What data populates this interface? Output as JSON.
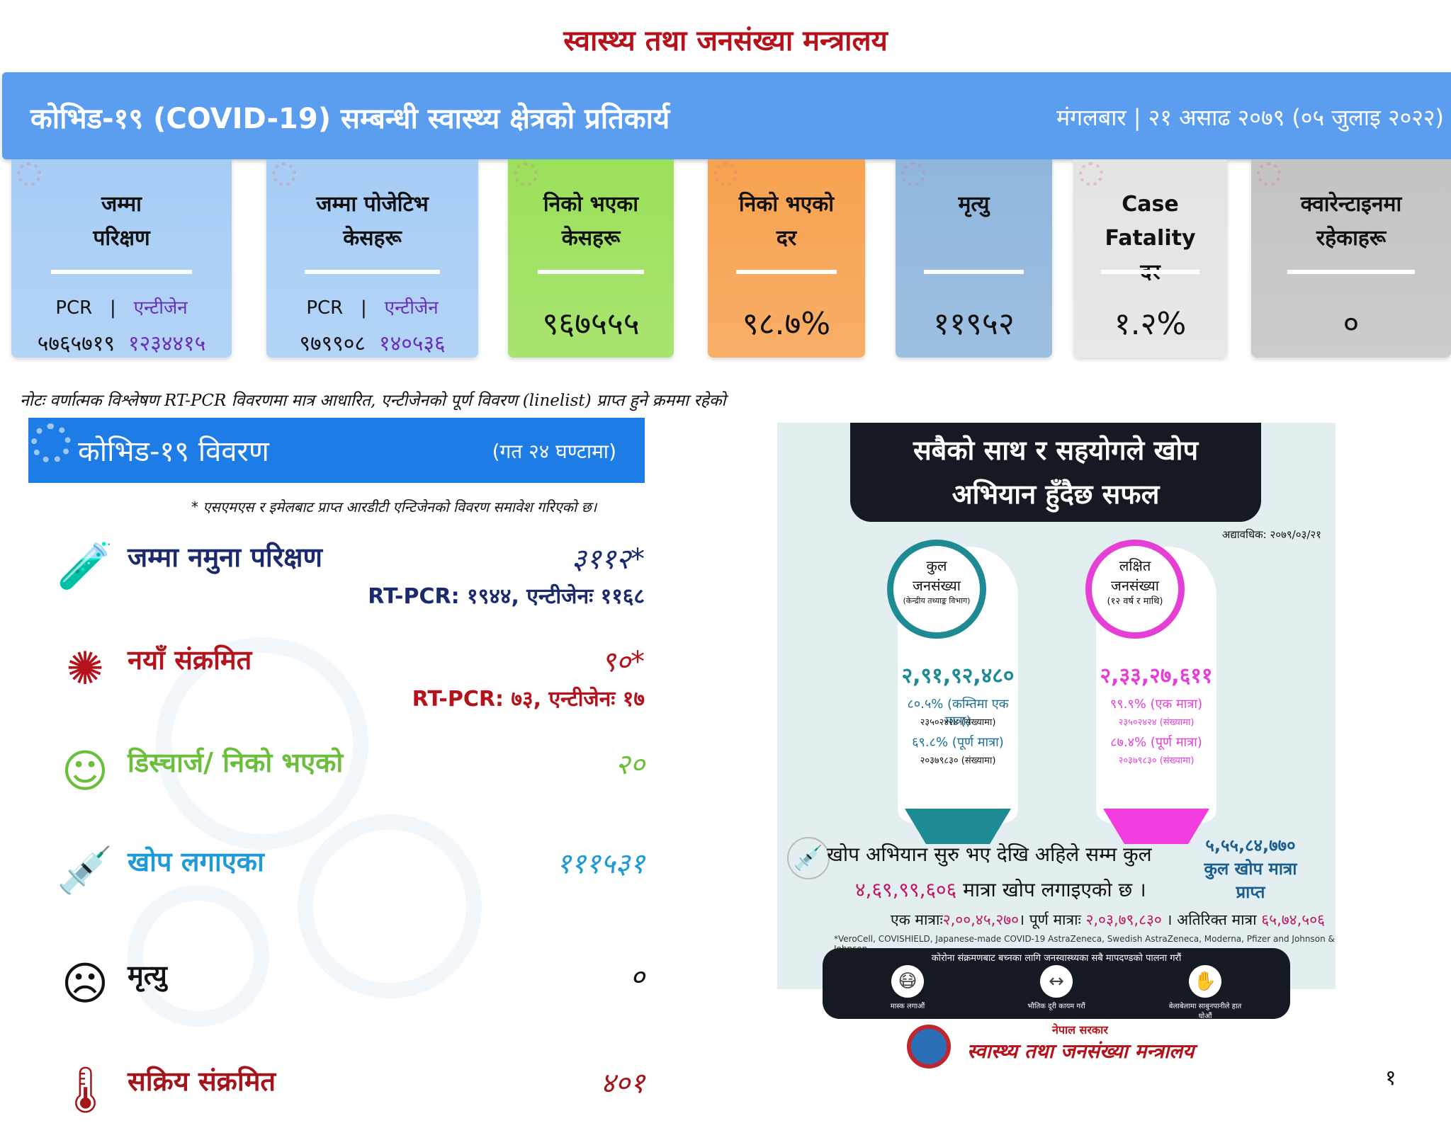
{
  "header": {
    "ministry": "स्वास्थ्य तथा जनसंख्या मन्त्रालय",
    "banner_title": "कोभिड-१९ (COVID-19) सम्बन्धी स्वास्थ्य क्षेत्रको प्रतिकार्य",
    "date": "मंगलबार | २१ असाढ २०७९ (०५ जुलाइ २०२२)"
  },
  "cards": [
    {
      "title1": "जम्मा",
      "title2": "परिक्षण",
      "pcr_label": "PCR",
      "sep": "|",
      "antigen_label": "एन्टीजेन",
      "pcr_value": "५७६५७१९",
      "antigen_value": "१२३४४१५",
      "color": "#a7cdf5"
    },
    {
      "title1": "जम्मा पोजेटिभ",
      "title2": "केसहरू",
      "pcr_label": "PCR",
      "sep": "|",
      "antigen_label": "एन्टीजेन",
      "pcr_value": "९७९९०८",
      "antigen_value": "१४०५३६",
      "color": "#a7cdf5"
    },
    {
      "title1": "निको भएका",
      "title2": "केसहरू",
      "value": "९६७५५५",
      "color": "#9be05a"
    },
    {
      "title1": "निको भएको",
      "title2": "दर",
      "value": "९८.७%",
      "color": "#f7a250"
    },
    {
      "title1": "मृत्यु",
      "title2": "",
      "value": "११९५२",
      "color": "#8fb6dc"
    },
    {
      "title1": "Case",
      "title2": "Fatality",
      "title3": "दर",
      "value": "१.२%",
      "color": "#e4e4e4"
    },
    {
      "title1": "क्वारेन्टाइनमा",
      "title2": "रहेकाहरू",
      "value": "०",
      "color": "#c4c4c4"
    }
  ],
  "note": "नोटः वर्णात्मक विश्लेषण RT-PCR विवरणमा मात्र आधारित, एन्टीजेनको पूर्ण विवरण (linelist) प्राप्त हुने क्रममा रहेको",
  "section": {
    "title": "कोभिड-१९ विवरण",
    "period": "(गत २४ घण्टामा)",
    "asterisk_note": "* एसएमएस र इमेलबाट प्राप्त आरडीटी एन्टिजेनको विवरण समावेश गरिएको छ।"
  },
  "rows": [
    {
      "icon": "test-tube-icon",
      "label": "जम्मा नमुना परिक्षण",
      "value": "३११२*",
      "sub": "RT-PCR: १९४४, एन्टीजेनः ११६८",
      "color": "#1a2a6c"
    },
    {
      "icon": "virus-icon",
      "label": "नयाँ संक्रमित",
      "value": "९०*",
      "sub": "RT-PCR: ७३,  एन्टीजेनः १७",
      "color": "#b5121b"
    },
    {
      "icon": "smile-icon",
      "label": "डिस्चार्ज/ निको भएको",
      "value": "२०",
      "color": "#6cbf3c"
    },
    {
      "icon": "syringe-icon",
      "label": "खोप लगाएका",
      "value": "१११५३१",
      "color": "#1e9ad6"
    },
    {
      "icon": "sad-icon",
      "label": "मृत्यु",
      "value": "०",
      "color": "#111111"
    },
    {
      "icon": "thermometer-icon",
      "label": "सक्रिय संक्रमित",
      "value": "४०१",
      "color": "#a3141b"
    }
  ],
  "infographic": {
    "headline1": "सबैको साथ र सहयोगले खोप",
    "headline2": "अभियान हुँदैछ सफल",
    "as_of": "अद्यावधिक: २०७९/०३/२१",
    "total_pop": {
      "l1": "कुल",
      "l2": "जनसंख्या",
      "l3": "(केन्द्रीय तथ्याङ्क विभाग)",
      "value": "२,९१,९२,४८०",
      "p1": "८०.५% (कम्तिमा एक मात्रा)",
      "c1": "२३५०२४२४ (संख्यामा)",
      "p2": "६९.८% (पूर्ण मात्रा)",
      "c2": "२०३७९८३० (संख्यामा)",
      "color": "#1e8a94"
    },
    "target_pop": {
      "l1": "लक्षित",
      "l2": "जनसंख्या",
      "l3": "(१२ वर्ष र माथि)",
      "value": "२,३३,२७,६११",
      "p1": "९९.९% (एक मात्रा)",
      "c1": "२३५०२४२४ (संख्यामा)",
      "p2": "८७.४% (पूर्ण मात्रा)",
      "c2": "२०३७९८३० (संख्यामा)",
      "color": "#e63fd6"
    },
    "msg1": "खोप अभियान सुरु भए देखि अहिले सम्म कुल",
    "msg2_num": "४,६९,९९,६०६",
    "msg2_text": " मात्रा खोप लगाइएको छ ।",
    "total_received": "५,५५,८४,७७०",
    "total_received_label": "कुल खोप मात्रा प्राप्त",
    "d1_label": "एक मात्राः",
    "d1": "२,००,४५,२७०",
    "d2_label": "। पूर्ण मात्राः ",
    "d2": "२,०३,७९,८३०",
    "d3_label": " । अतिरिक्त मात्रा ",
    "d3": "६५,७४,५०६",
    "vaccines": "*VeroCell, COVISHIELD, Japanese-made COVID-19 AstraZeneca, Swedish AstraZeneca, Moderna, Pfizer and Johnson & Johnson",
    "advice": "कोरोना संक्रमणबाट बच्नका लागि जनस्वास्थ्यका सबै मापदण्डको पालना गरौं",
    "tips": [
      "मास्क लगाऔं",
      "भौतिक दूरी कायम गरौं",
      "बेलाबेलामा साबुनपानीले हात धोऔं"
    ]
  },
  "footer": {
    "govt": "नेपाल सरकार",
    "ministry": "स्वास्थ्य तथा जनसंख्या मन्त्रालय"
  },
  "page_number": "१"
}
